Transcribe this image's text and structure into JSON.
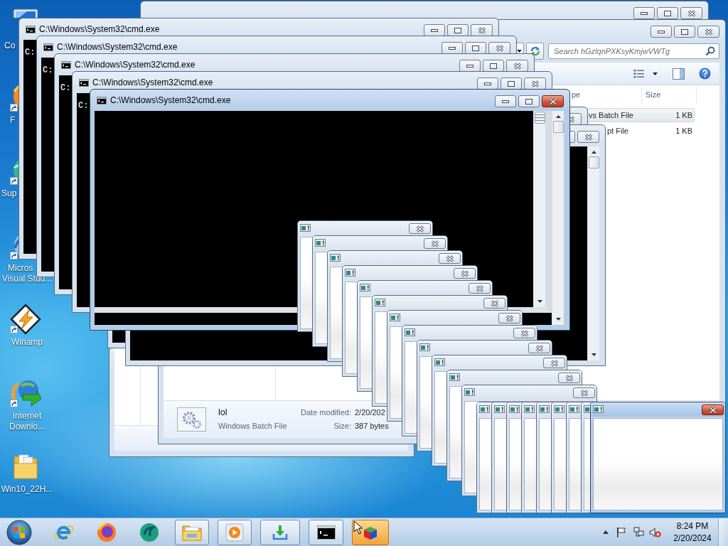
{
  "desktop_icons": [
    {
      "label": [
        "Co"
      ],
      "shortcut": false
    },
    {
      "label": [
        "F"
      ],
      "shortcut": true
    },
    {
      "label": [
        "Sup"
      ],
      "shortcut": true
    },
    {
      "label": [
        "Micros",
        "Visual Stud..."
      ],
      "shortcut": true
    },
    {
      "label": [
        "Winamp"
      ],
      "shortcut": true
    },
    {
      "label": [
        "Internet",
        "Downlo..."
      ],
      "shortcut": true
    },
    {
      "label": [
        "Win10_22H..."
      ],
      "shortcut": false
    }
  ],
  "explorer_windows": [
    {
      "active": false
    },
    {
      "active": false
    },
    {
      "active": false,
      "search": {
        "placeholder": "Search hGzlqnPXKsyKmjwVWTg"
      },
      "columns": [
        "pe",
        "Size"
      ],
      "files": [
        {
          "type": "vs Batch File",
          "size": "1 KB",
          "selected": true
        },
        {
          "type": "pt File",
          "size": "1 KB",
          "selected": false
        }
      ],
      "details": {
        "name": "lol",
        "type": "Windows Batch File",
        "date_label": "Date modified:",
        "date": "2/20/202",
        "size_label": "Size:",
        "size": "387 bytes"
      }
    }
  ],
  "console_windows": [
    {
      "title": "C:\\Windows\\System32\\cmd.exe",
      "text": "C:",
      "active": false
    },
    {
      "title": "C:\\Windows\\System32\\cmd.exe",
      "text": "C:",
      "active": false
    },
    {
      "title": "C:\\Windows\\System32\\cmd.exe",
      "text": "C:",
      "active": false
    },
    {
      "title": "C:\\Windows\\System32\\cmd.exe",
      "text": "C:",
      "active": false
    },
    {
      "title": "C:\\Windows\\System32\\cmd.exe",
      "active": true
    },
    {
      "active": false
    },
    {
      "active": false
    }
  ],
  "dialogs": [
    {
      "active": false
    },
    {
      "active": false
    },
    {
      "active": false
    },
    {
      "active": false
    },
    {
      "active": false
    },
    {
      "active": false
    },
    {
      "active": false
    },
    {
      "active": false
    },
    {
      "active": false
    },
    {
      "active": false
    },
    {
      "active": false
    },
    {
      "active": false
    },
    {
      "active": false
    },
    {
      "active": false
    },
    {
      "active": false
    },
    {
      "active": false
    },
    {
      "active": false
    },
    {
      "active": false
    },
    {
      "active": false
    },
    {
      "active": false
    },
    {
      "active": true
    }
  ],
  "taskbar": {
    "items": [
      {
        "running": false,
        "flashing": false
      },
      {
        "running": false,
        "flashing": false
      },
      {
        "running": false,
        "flashing": false
      },
      {
        "running": true,
        "flashing": false
      },
      {
        "running": true,
        "flashing": false
      },
      {
        "running": true,
        "flashing": false
      },
      {
        "running": true,
        "flashing": false
      },
      {
        "running": true,
        "flashing": true
      }
    ],
    "clock": {
      "time": "8:24 PM",
      "date": "2/20/2024"
    }
  }
}
